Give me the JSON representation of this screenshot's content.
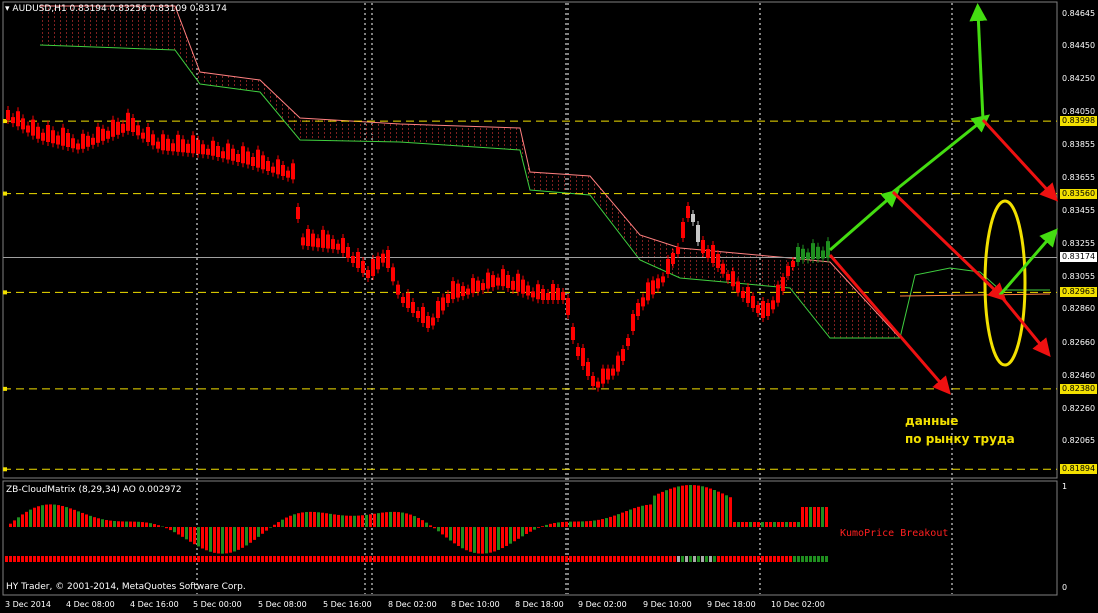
{
  "header": {
    "symbol": "AUDUSD,H1",
    "ohlc": "0.83194 0.83256 0.83109 0.83174"
  },
  "indicator": {
    "name": "ZB-CloudMatrix (8,29,34)",
    "ao": "AO 0.002972",
    "copyright": "HY Trader, © 2001-2014, MetaQuotes Software Corp.",
    "note": "KumoPrice Breakout",
    "axis_top": "1",
    "axis_bottom": "0"
  },
  "annotation": {
    "line1": "данные",
    "line2": "по рынку труда"
  },
  "price_axis": [
    "0.84645",
    "0.84450",
    "0.84250",
    "0.84050",
    "0.83855",
    "0.83655",
    "0.83455",
    "0.83255",
    "0.83055",
    "0.82860",
    "0.82660",
    "0.82460",
    "0.82260",
    "0.82065"
  ],
  "price_levels": [
    {
      "value": "0.83998",
      "price": 0.83998
    },
    {
      "value": "0.83560",
      "price": 0.8356
    },
    {
      "value": "0.82963",
      "price": 0.82963
    },
    {
      "value": "0.82380",
      "price": 0.8238
    },
    {
      "value": "0.81894",
      "price": 0.81894
    }
  ],
  "current_price": {
    "value": "0.83174",
    "price": 0.83174
  },
  "time_axis": [
    "3 Dec 2014",
    "4 Dec 08:00",
    "4 Dec 16:00",
    "5 Dec 00:00",
    "5 Dec 08:00",
    "5 Dec 16:00",
    "8 Dec 02:00",
    "8 Dec 10:00",
    "8 Dec 18:00",
    "9 Dec 02:00",
    "9 Dec 10:00",
    "9 Dec 18:00",
    "10 Dec 02:00"
  ],
  "colors": {
    "background": "#000000",
    "grid": "#ffffff",
    "level": "#f2e000",
    "bear": "#ff0000",
    "bull": "#1f8f1f",
    "neutral": "#c8c8c8",
    "arrow_up": "#44dd11",
    "arrow_down": "#ee1111",
    "ellipse": "#f2e000"
  }
}
